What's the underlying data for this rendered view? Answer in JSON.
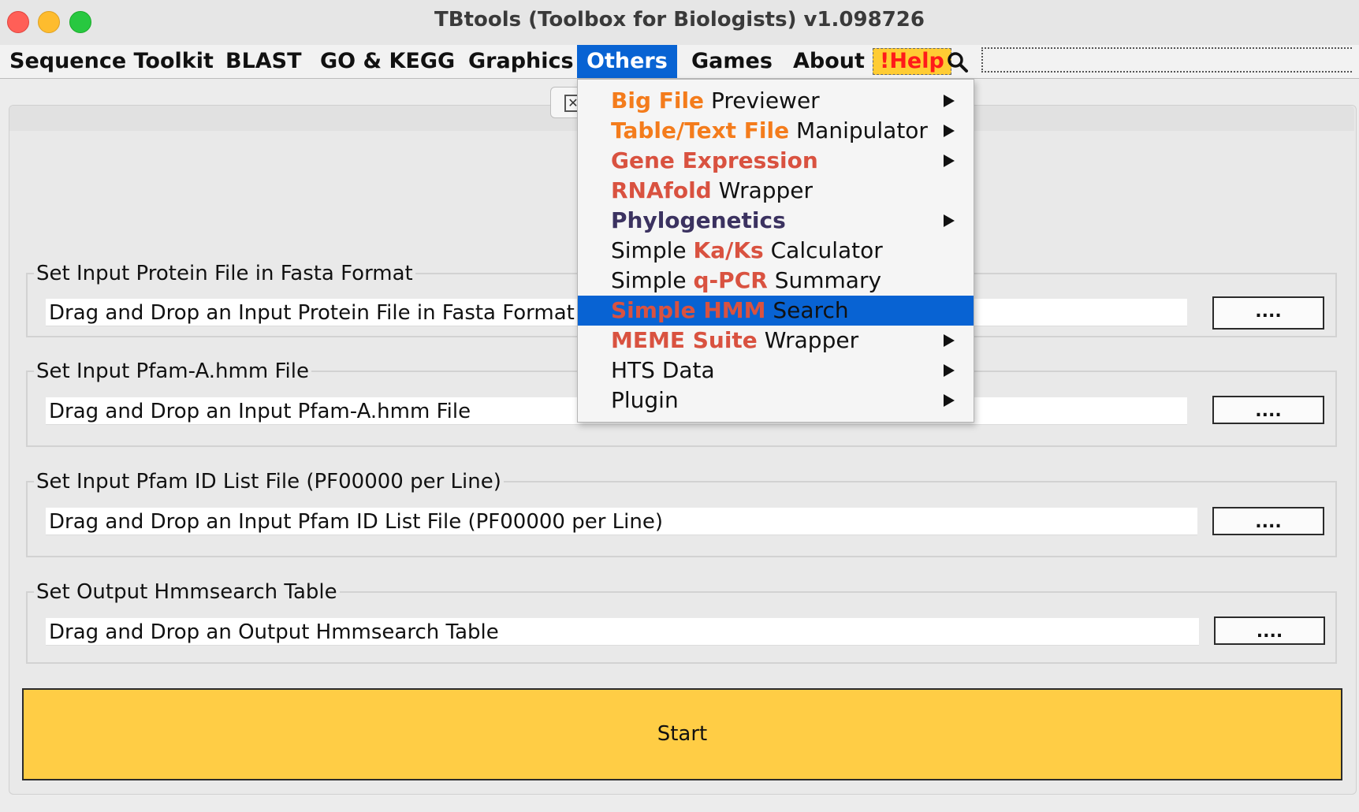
{
  "window": {
    "title": "TBtools (Toolbox for Biologists) v1.098726"
  },
  "menubar": {
    "items": [
      "Sequence Toolkit",
      "BLAST",
      "GO & KEGG",
      "Graphics",
      "Others",
      "Games",
      "About",
      "!Help"
    ],
    "active": "Others",
    "search_icon": "magnifier-icon"
  },
  "heading": {
    "visible_text": "Simple HMM Search"
  },
  "groups": [
    {
      "legend": "Set Input Protein File in Fasta Format",
      "value": "Drag and Drop an Input Protein File in Fasta Format",
      "button": "...."
    },
    {
      "legend": "Set Input Pfam-A.hmm File",
      "value": "Drag and Drop an Input Pfam-A.hmm File",
      "button": "...."
    },
    {
      "legend": "Set Input Pfam ID List File (PF00000 per Line)",
      "value": "Drag and Drop an Input Pfam ID List File (PF00000 per Line)",
      "button": "...."
    },
    {
      "legend": "Set Output Hmmsearch Table",
      "value": "Drag and Drop an Output Hmmsearch Table",
      "button": "...."
    }
  ],
  "start_button": "Start",
  "others_menu": [
    {
      "parts": [
        [
          "Big File",
          "orange"
        ],
        [
          " Previewer",
          "plain"
        ]
      ],
      "submenu": true
    },
    {
      "parts": [
        [
          "Table/Text File",
          "orange"
        ],
        [
          " Manipulator",
          "plain"
        ]
      ],
      "submenu": true
    },
    {
      "parts": [
        [
          "Gene Expression",
          "red"
        ]
      ],
      "submenu": true
    },
    {
      "parts": [
        [
          "RNAfold",
          "red"
        ],
        [
          " Wrapper",
          "plain"
        ]
      ],
      "submenu": false
    },
    {
      "parts": [
        [
          "Phylogenetics",
          "navy"
        ]
      ],
      "submenu": true
    },
    {
      "parts": [
        [
          "Simple ",
          "plain"
        ],
        [
          "Ka/Ks",
          "red"
        ],
        [
          " Calculator",
          "plain"
        ]
      ],
      "submenu": false
    },
    {
      "parts": [
        [
          "Simple ",
          "plain"
        ],
        [
          "q-PCR",
          "red"
        ],
        [
          " Summary",
          "plain"
        ]
      ],
      "submenu": false
    },
    {
      "parts": [
        [
          "Simple HMM",
          "red"
        ],
        [
          " Search",
          "plain"
        ]
      ],
      "submenu": false,
      "highlighted": true
    },
    {
      "parts": [
        [
          "MEME Suite",
          "red"
        ],
        [
          " Wrapper",
          "plain"
        ]
      ],
      "submenu": true
    },
    {
      "parts": [
        [
          "HTS Data",
          "plain"
        ]
      ],
      "submenu": true
    },
    {
      "parts": [
        [
          "Plugin",
          "plain"
        ]
      ],
      "submenu": true
    }
  ],
  "colors": {
    "menu_highlight": "#0863d3",
    "start_button": "#ffcd45",
    "help_bg": "#ffcc33",
    "help_text": "#ff1a1a",
    "orange": "#f47c1c",
    "red": "#d95240",
    "navy": "#3b3260"
  }
}
